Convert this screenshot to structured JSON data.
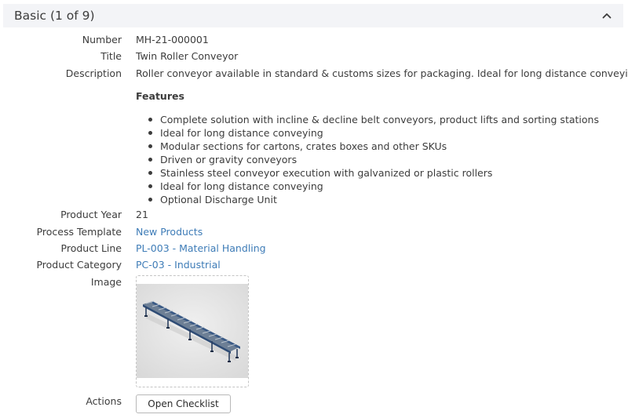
{
  "section": {
    "title": "Basic (1 of 9)"
  },
  "fields": {
    "number": {
      "label": "Number",
      "value": "MH-21-000001"
    },
    "title": {
      "label": "Title",
      "value": "Twin Roller Conveyor"
    },
    "description": {
      "label": "Description",
      "value": "Roller conveyor available in standard & customs sizes for packaging. Ideal for long distance conveying."
    },
    "features": {
      "heading": "Features",
      "items": [
        "Complete solution with incline & decline belt conveyors, product lifts and sorting stations",
        "Ideal for long distance conveying",
        "Modular sections for cartons, crates boxes and other SKUs",
        "Driven or gravity conveyors",
        "Stainless steel conveyor execution with galvanized or plastic rollers",
        "Ideal for long distance conveying",
        "Optional Discharge Unit"
      ]
    },
    "product_year": {
      "label": "Product Year",
      "value": "21"
    },
    "process_template": {
      "label": "Process Template",
      "value": "New Products"
    },
    "product_line": {
      "label": "Product Line",
      "value": "PL-003 - Material Handling"
    },
    "product_category": {
      "label": "Product Category",
      "value": "PC-03 - Industrial"
    },
    "image": {
      "label": "Image"
    },
    "actions": {
      "label": "Actions",
      "button_label": "Open Checklist"
    }
  },
  "colors": {
    "link": "#3e7cb7",
    "header_bg": "#f3f4f7",
    "conveyor_frame": "#3a5a86"
  },
  "icons": {
    "collapse": "chevron-up-icon"
  }
}
